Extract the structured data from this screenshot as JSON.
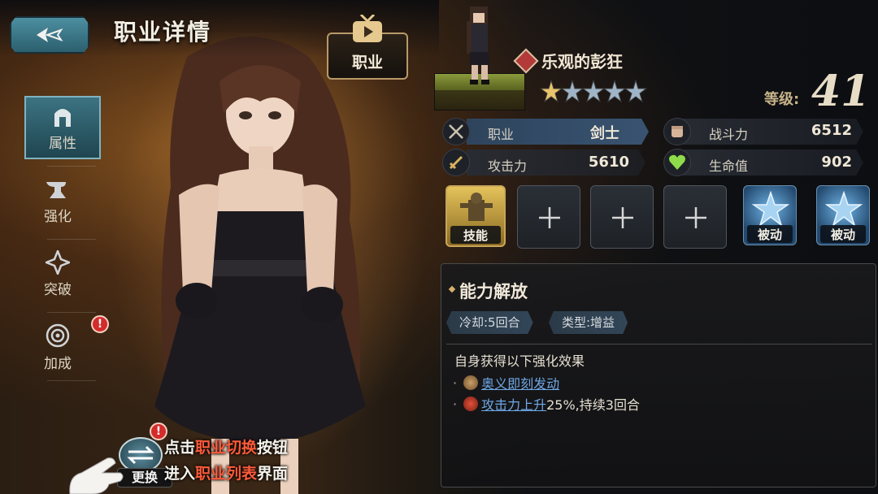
{
  "header": {
    "title": "职业详情",
    "job_button_label": "职业"
  },
  "side_nav": [
    {
      "label": "属性",
      "icon": "helmet-icon",
      "active": true
    },
    {
      "label": "强化",
      "icon": "anvil-icon",
      "active": false
    },
    {
      "label": "突破",
      "icon": "shuriken-icon",
      "active": false
    },
    {
      "label": "加成",
      "icon": "target-icon",
      "active": false
    }
  ],
  "alerts": {
    "nav_badge": "!",
    "swap_badge": "!"
  },
  "swap": {
    "label": "更换"
  },
  "hint": {
    "line1_prefix": "点击",
    "line1_highlight": "职业切换",
    "line1_suffix": "按钮",
    "line2_prefix": "进入",
    "line2_highlight": "职业列表",
    "line2_suffix": "界面"
  },
  "job": {
    "name": "乐观的彭狂",
    "stars": 5,
    "level_label": "等级:",
    "level": "41"
  },
  "stats": {
    "class_label": "职业",
    "class_value": "剑士",
    "power_label": "战斗力",
    "power_value": "6512",
    "attack_label": "攻击力",
    "attack_value": "5610",
    "hp_label": "生命值",
    "hp_value": "902"
  },
  "slots": [
    {
      "type": "skill",
      "label": "技能"
    },
    {
      "type": "empty"
    },
    {
      "type": "empty"
    },
    {
      "type": "empty"
    },
    {
      "type": "passive",
      "label": "被动"
    },
    {
      "type": "passive",
      "label": "被动"
    }
  ],
  "skill_detail": {
    "name": "能力解放",
    "cooldown": "冷却:5回合",
    "category": "类型:增益",
    "subtitle": "自身获得以下强化效果",
    "effect1_link": "奥义即刻发动",
    "effect2_link": "攻击力上升",
    "effect2_text": "25%,持续3回合"
  },
  "colors": {
    "accent_blue": "#3c7382",
    "highlight_red": "#ff5b3b",
    "link_blue": "#6fa8e6"
  }
}
